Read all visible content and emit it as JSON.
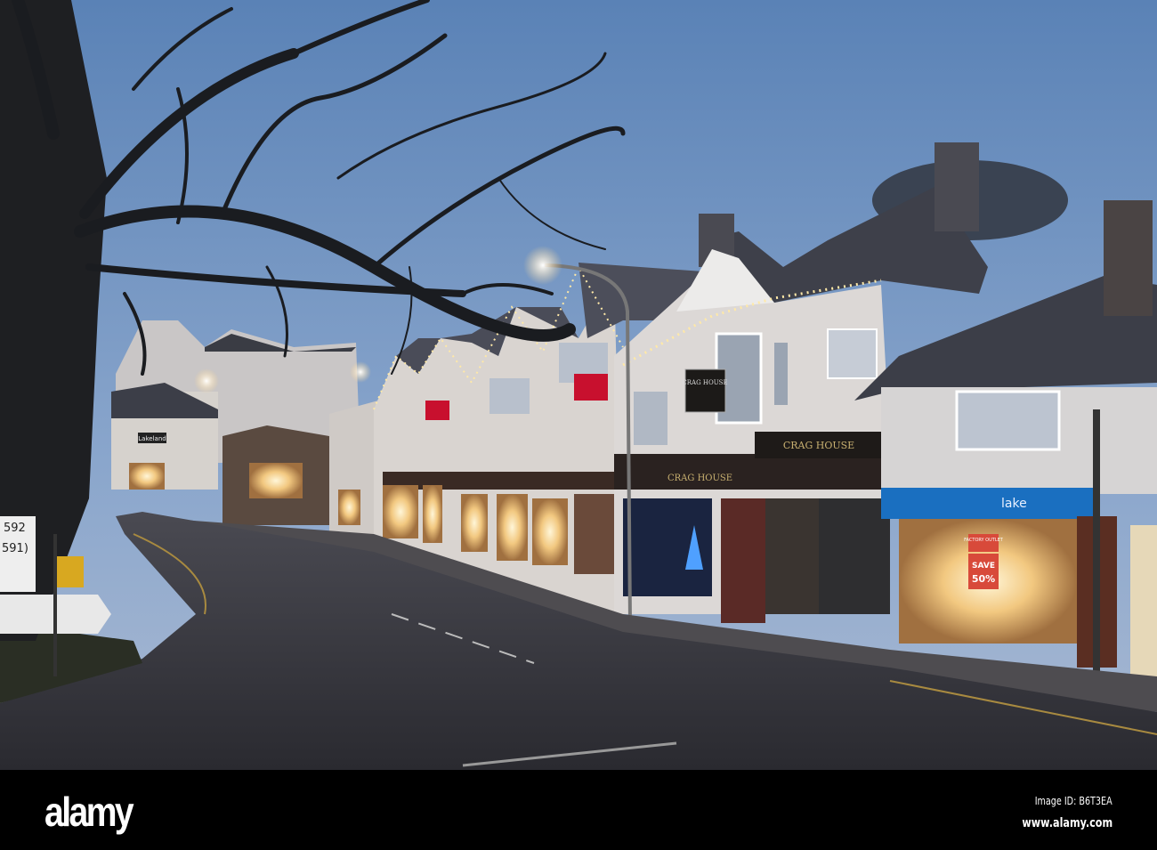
{
  "photo": {
    "signs": {
      "crag_house_hanging": "CRAG HOUSE",
      "crag_house_fascia": "CRAG HOUSE",
      "crag_house_fascia2": "CRAG HOUSE",
      "lakeland_small": "Lakeland",
      "shop_fascia": "lake",
      "factory_outlet": "FACTORY OUTLET",
      "save": "SAVE",
      "save_pct": "50%",
      "road_sign_1": "592",
      "road_sign_2": "591)"
    }
  },
  "watermark": {
    "logo": "alamy",
    "image_id": "Image ID: B6T3EA",
    "url": "www.alamy.com"
  }
}
